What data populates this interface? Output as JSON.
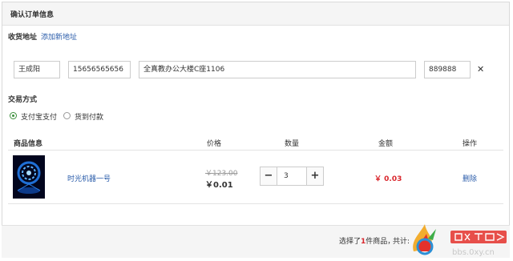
{
  "panel": {
    "title": "确认订单信息"
  },
  "address": {
    "label": "收货地址",
    "add_link": "添加新地址",
    "name": "王成阳",
    "phone": "15656565656",
    "detail": "全真教办公大楼C座1106",
    "zip": "889888"
  },
  "payment": {
    "label": "交易方式",
    "options": [
      {
        "label": "支付宝支付",
        "checked": true
      },
      {
        "label": "货到付款",
        "checked": false
      }
    ]
  },
  "table": {
    "headers": [
      "商品信息",
      "价格",
      "数量",
      "金额",
      "操作"
    ],
    "rows": [
      {
        "name": "时光机器一号",
        "old_price": "￥123.00",
        "price": "￥0.01",
        "quantity": "3",
        "amount": "￥ 0.03",
        "action": "删除"
      }
    ]
  },
  "footer": {
    "summary_prefix": "选择了",
    "summary_count": "1",
    "summary_suffix": "件商品，",
    "total_label": "共计:"
  },
  "watermark": {
    "text": "bbs.0xy.cn"
  },
  "colors": {
    "accent_red": "#d9262c",
    "link_blue": "#2a5caa",
    "radio_green": "#3c8f3c"
  }
}
